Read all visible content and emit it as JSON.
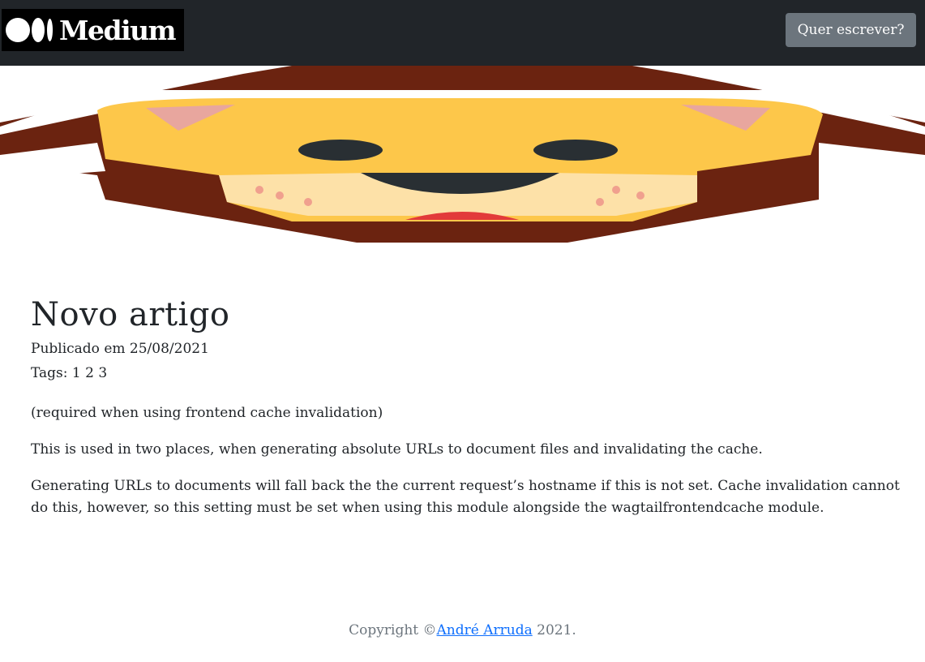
{
  "navbar": {
    "brand_name": "Medium",
    "write_button_label": "Quer escrever?"
  },
  "hero": {
    "icon": "lion-face-emoji",
    "colors": {
      "mane": "#6b2310",
      "face": "#fdc74a",
      "ear_inner": "#e8a69e",
      "muzzle": "#fde1a8",
      "eyes": "#292f33",
      "mouth": "#e23a3a",
      "cheek_dots": "#f0a08e"
    }
  },
  "article": {
    "title": "Novo artigo",
    "published": "Publicado em 25/08/2021",
    "tags_label": "Tags:",
    "tags": [
      "1",
      "2",
      "3"
    ],
    "paragraphs": [
      "(required when using frontend cache invalidation)",
      "This is used in two places, when generating absolute URLs to document files and invalidating the cache.",
      "Generating URLs to documents will fall back the the current request’s hostname if this is not set. Cache invalidation cannot do this, however, so this setting must be set when using this module alongside the wagtailfrontendcache module."
    ]
  },
  "footer": {
    "prefix": "Copyright ©",
    "author": "André Arruda",
    "suffix": " 2021."
  },
  "colors": {
    "navbar_bg": "#212529",
    "button_bg": "#6c757d",
    "link": "#0d6efd",
    "muted_text": "#6c757d"
  }
}
